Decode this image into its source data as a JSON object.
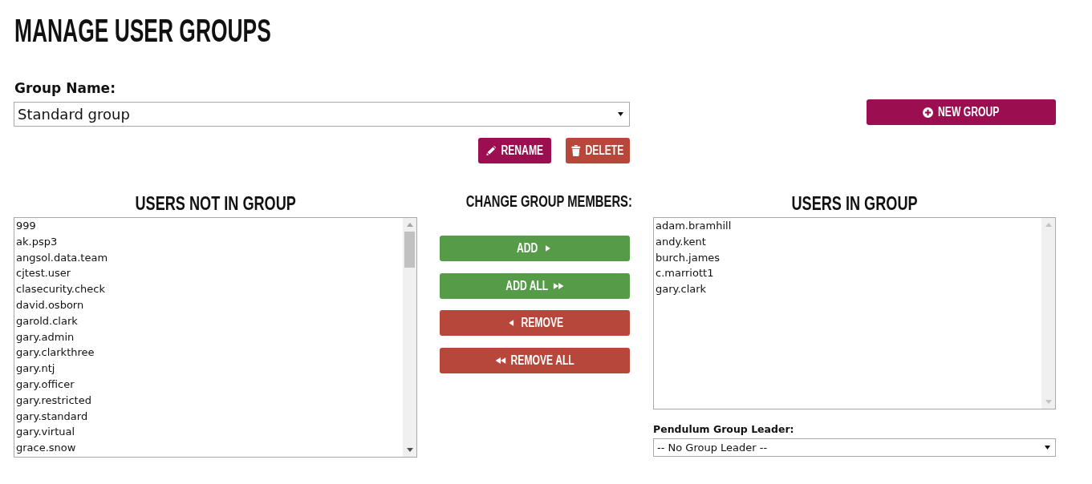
{
  "page": {
    "title": "MANAGE USER GROUPS"
  },
  "group_name": {
    "label": "Group Name:",
    "value": "Standard group"
  },
  "group_actions": [
    {
      "kind": "rename",
      "label": "RENAME"
    },
    {
      "kind": "delete",
      "label": "DELETE"
    }
  ],
  "new_group_button": {
    "label": "NEW GROUP"
  },
  "users_not_in_group": {
    "heading": "USERS NOT IN GROUP",
    "items": [
      {
        "name": "999",
        "selected": false
      },
      {
        "name": "ak.psp3",
        "selected": false
      },
      {
        "name": "angsol.data.team",
        "selected": false
      },
      {
        "name": "cjtest.user",
        "selected": false
      },
      {
        "name": "clasecurity.check",
        "selected": false
      },
      {
        "name": "david.osborn",
        "selected": false
      },
      {
        "name": "garold.clark",
        "selected": false
      },
      {
        "name": "gary.admin",
        "selected": false
      },
      {
        "name": "gary.clarkthree",
        "selected": false
      },
      {
        "name": "gary.ntj",
        "selected": false
      },
      {
        "name": "gary.officer",
        "selected": false
      },
      {
        "name": "gary.restricted",
        "selected": false
      },
      {
        "name": "gary.standard",
        "selected": false
      },
      {
        "name": "gary.virtual",
        "selected": false
      },
      {
        "name": "grace.snow",
        "selected": false
      }
    ]
  },
  "change_members": {
    "heading": "CHANGE GROUP MEMBERS:",
    "buttons": [
      {
        "kind": "add",
        "label": "ADD"
      },
      {
        "kind": "add_all",
        "label": "ADD ALL"
      },
      {
        "kind": "remove",
        "label": "REMOVE"
      },
      {
        "kind": "remove_all",
        "label": "REMOVE ALL"
      }
    ]
  },
  "users_in_group": {
    "heading": "USERS IN GROUP",
    "items": [
      {
        "name": "adam.bramhill",
        "selected": false
      },
      {
        "name": "andy.kent",
        "selected": false
      },
      {
        "name": "burch.james",
        "selected": false
      },
      {
        "name": "c.marriott1",
        "selected": false
      },
      {
        "name": "gary.clark",
        "selected": false
      }
    ]
  },
  "group_leader": {
    "label": "Pendulum Group Leader:",
    "value": "-- No Group Leader --"
  }
}
